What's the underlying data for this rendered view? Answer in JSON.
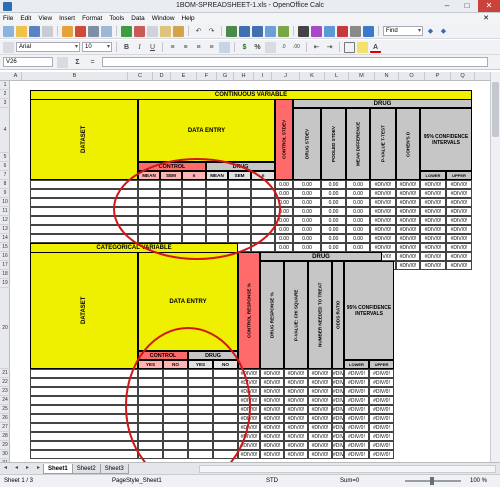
{
  "window": {
    "title": "1BOM-SPREADSHEET-1.xls - OpenOffice Calc"
  },
  "menu": [
    "File",
    "Edit",
    "View",
    "Insert",
    "Format",
    "Tools",
    "Data",
    "Window",
    "Help"
  ],
  "toolbar": {
    "font_name": "Arial",
    "font_size": "10",
    "find_placeholder": "Find"
  },
  "formula": {
    "cell_ref": "V26",
    "content": ""
  },
  "columns": [
    "A",
    "B",
    "C",
    "D",
    "E",
    "F",
    "G",
    "H",
    "I",
    "J",
    "K",
    "L",
    "M",
    "N",
    "O",
    "P",
    "Q"
  ],
  "rows": [
    "1",
    "2",
    "3",
    "4",
    "5",
    "6",
    "7",
    "8",
    "9",
    "10",
    "11",
    "12",
    "13",
    "14",
    "15",
    "16",
    "17",
    "18",
    "19",
    "20",
    "21",
    "22",
    "23",
    "24",
    "25",
    "26",
    "27",
    "28",
    "29",
    "30",
    "31",
    "32"
  ],
  "section1": {
    "title": "CONTINUOUS VARIABLE",
    "dataset": "DATASET",
    "data_entry": "DATA ENTRY",
    "drug_header": "DRUG",
    "control_label": "CONTROL",
    "drug_label": "DRUG",
    "sub_headers": [
      "MEAN",
      "SEM",
      "n",
      "MEAN",
      "SEM",
      "n"
    ],
    "calc_headers": [
      "CONTROL STDEV",
      "DRUG STDEV",
      "POOLED STDEV",
      "MEAN DIFFERENCE",
      "P-VALUE T-TEST",
      "COHEN'S D"
    ],
    "ci_label": "95% CONFIDENCE INTERVALS",
    "lower": "LOWER",
    "upper": "UPPER",
    "zero_value": "0.00",
    "div_value": "#DIV/0!"
  },
  "section2": {
    "title": "CATEGORICAL VARIABLE",
    "dataset": "DATASET",
    "data_entry": "DATA ENTRY",
    "drug_header": "DRUG",
    "control_label": "CONTROL",
    "drug_label": "DRUG",
    "sub_headers": [
      "YES",
      "NO",
      "YES",
      "NO"
    ],
    "calc_headers": [
      "CONTROL RESPONSE %",
      "DRUG RESPONSE %",
      "P-VALUE: CHI SQUARE",
      "NUMBER NEEDED TO TREAT",
      "ODDS RATIO"
    ],
    "ci_label": "95% CONFIDENCE INTERVALS",
    "lower": "LOWER",
    "upper": "UPPER",
    "div_value": "#DIV/0!"
  },
  "sheet_tabs": [
    "Sheet1",
    "Sheet2",
    "Sheet3"
  ],
  "status": {
    "sheet": "Sheet 1 / 3",
    "style": "PageStyle_Sheet1",
    "mode": "STD",
    "sum": "Sum=0",
    "zoom": "100 %"
  },
  "annotation_color": "#d01818"
}
